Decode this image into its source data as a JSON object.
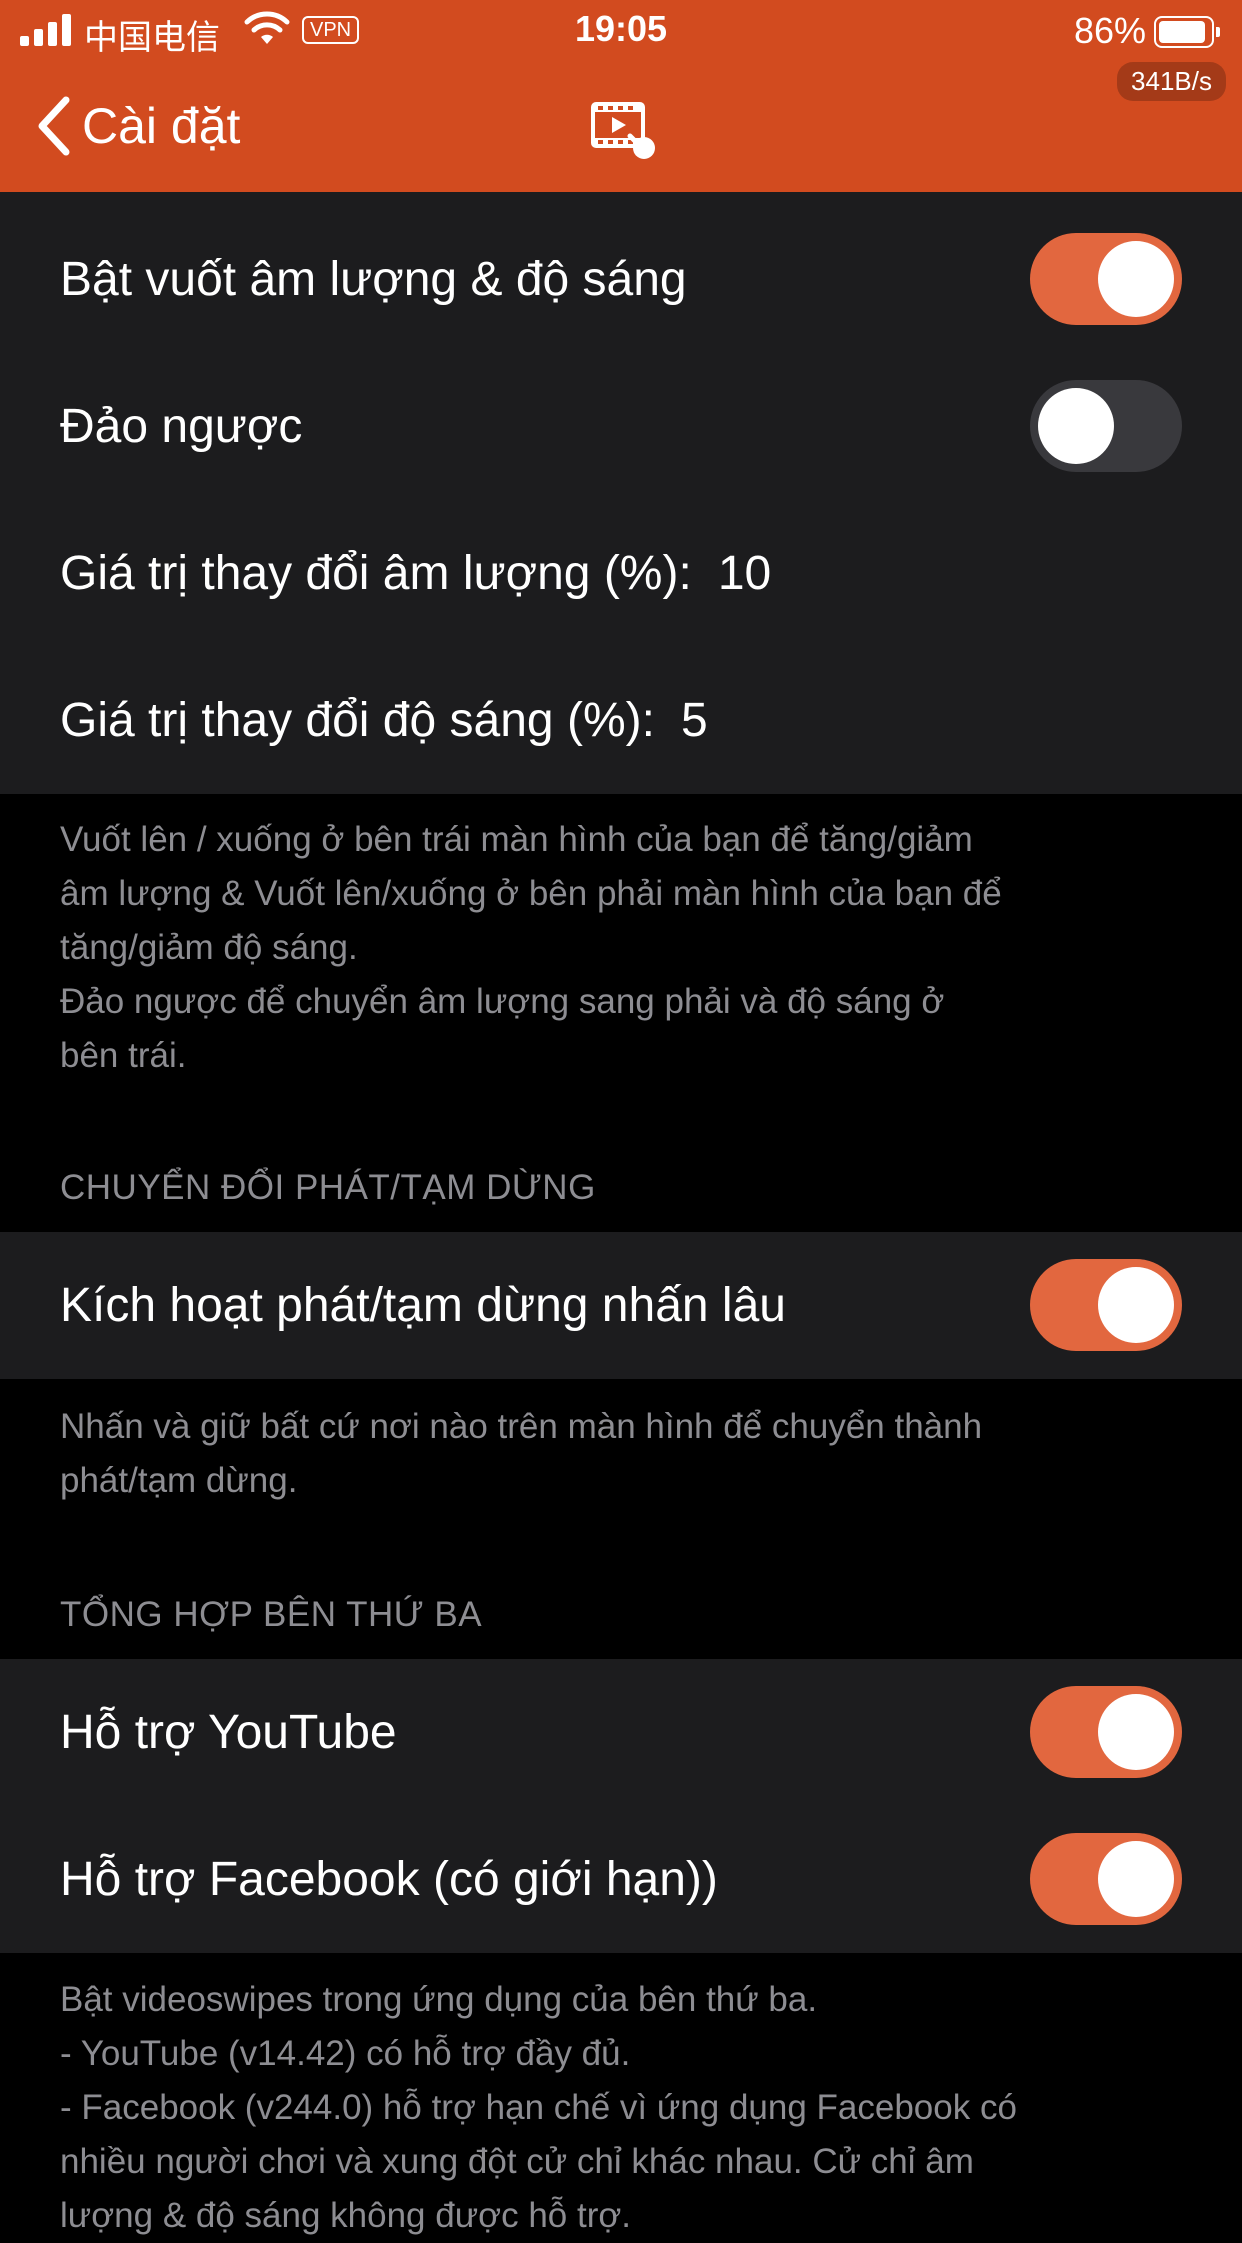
{
  "status_bar": {
    "carrier": "中国电信",
    "vpn": "VPN",
    "time": "19:05",
    "battery_percent": "86%",
    "net_speed": "341B/s",
    "battery_level": 0.86
  },
  "nav": {
    "back_label": "Cài đặt",
    "icon": "video-swipe-icon"
  },
  "colors": {
    "nav_background": "#d24b1f",
    "toggle_on": "#e2673f",
    "toggle_off": "#39393d",
    "cell_background": "#1c1c1e",
    "page_background": "#000000",
    "footer_text": "#8d8d92"
  },
  "group1": {
    "swipe_volume_brightness": {
      "label": "Bật vuốt âm lượng & độ sáng",
      "on": true
    },
    "invert": {
      "label": "Đảo ngược",
      "on": false
    },
    "volume_step": {
      "label": "Giá trị thay đổi âm lượng (%):",
      "value": "10"
    },
    "brightness_step": {
      "label": "Giá trị thay đổi độ sáng (%):",
      "value": "5"
    },
    "footer": [
      "Vuốt lên / xuống ở bên trái màn hình của bạn để tăng/giảm",
      "âm lượng & Vuốt lên/xuống ở bên phải màn hình của bạn để",
      "tăng/giảm độ sáng.",
      "Đảo ngược để chuyển âm lượng sang phải và độ sáng ở",
      "bên trái."
    ]
  },
  "group2": {
    "header": "CHUYỂN ĐỔI PHÁT/TẠM DỪNG",
    "long_press": {
      "label": "Kích hoạt phát/tạm dừng nhấn lâu",
      "on": true
    },
    "footer": [
      "Nhấn và giữ bất cứ nơi nào trên màn hình để chuyển thành",
      "phát/tạm dừng."
    ]
  },
  "group3": {
    "header": "TỔNG HỢP BÊN THỨ BA",
    "youtube": {
      "label": "Hỗ trợ YouTube",
      "on": true
    },
    "facebook": {
      "label": "Hỗ trợ Facebook (có giới hạn))",
      "on": true
    },
    "footer": [
      "Bật videoswipes trong ứng dụng của bên thứ ba.",
      "- YouTube (v14.42) có hỗ trợ đầy đủ.",
      "- Facebook (v244.0) hỗ trợ hạn chế vì ứng dụng Facebook có",
      "nhiều người chơi và xung đột cử chỉ khác nhau. Cử chỉ âm",
      "lượng & độ sáng không được hỗ trợ."
    ]
  }
}
